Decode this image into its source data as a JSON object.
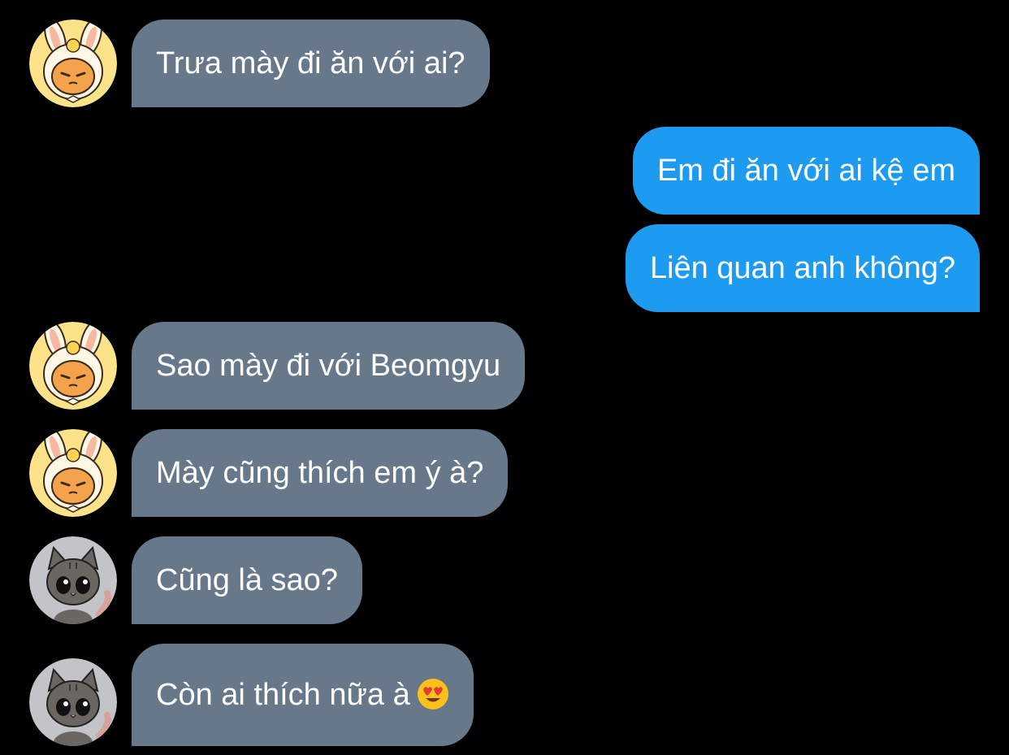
{
  "messages": [
    {
      "side": "in",
      "avatar": "bunny-hood-avatar",
      "text": "Trưa mày đi ăn với ai?"
    },
    {
      "side": "out",
      "text": "Em đi ăn với ai kệ em"
    },
    {
      "side": "out",
      "text": "Liên quan anh không?"
    },
    {
      "side": "in",
      "avatar": "bunny-hood-avatar",
      "text": "Sao mày đi với Beomgyu"
    },
    {
      "side": "in",
      "avatar": "bunny-hood-avatar",
      "text": "Mày cũng thích em ý à?"
    },
    {
      "side": "in",
      "avatar": "cat-avatar",
      "text": "Cũng là sao?"
    },
    {
      "side": "in",
      "avatar": "cat-avatar",
      "text": "Còn ai thích nữa à",
      "emoji": "heart-eyes-emoji"
    }
  ],
  "colors": {
    "background": "#000000",
    "incoming_bubble": "#66788a",
    "outgoing_bubble": "#1d9bf0",
    "text": "#ffffff"
  }
}
